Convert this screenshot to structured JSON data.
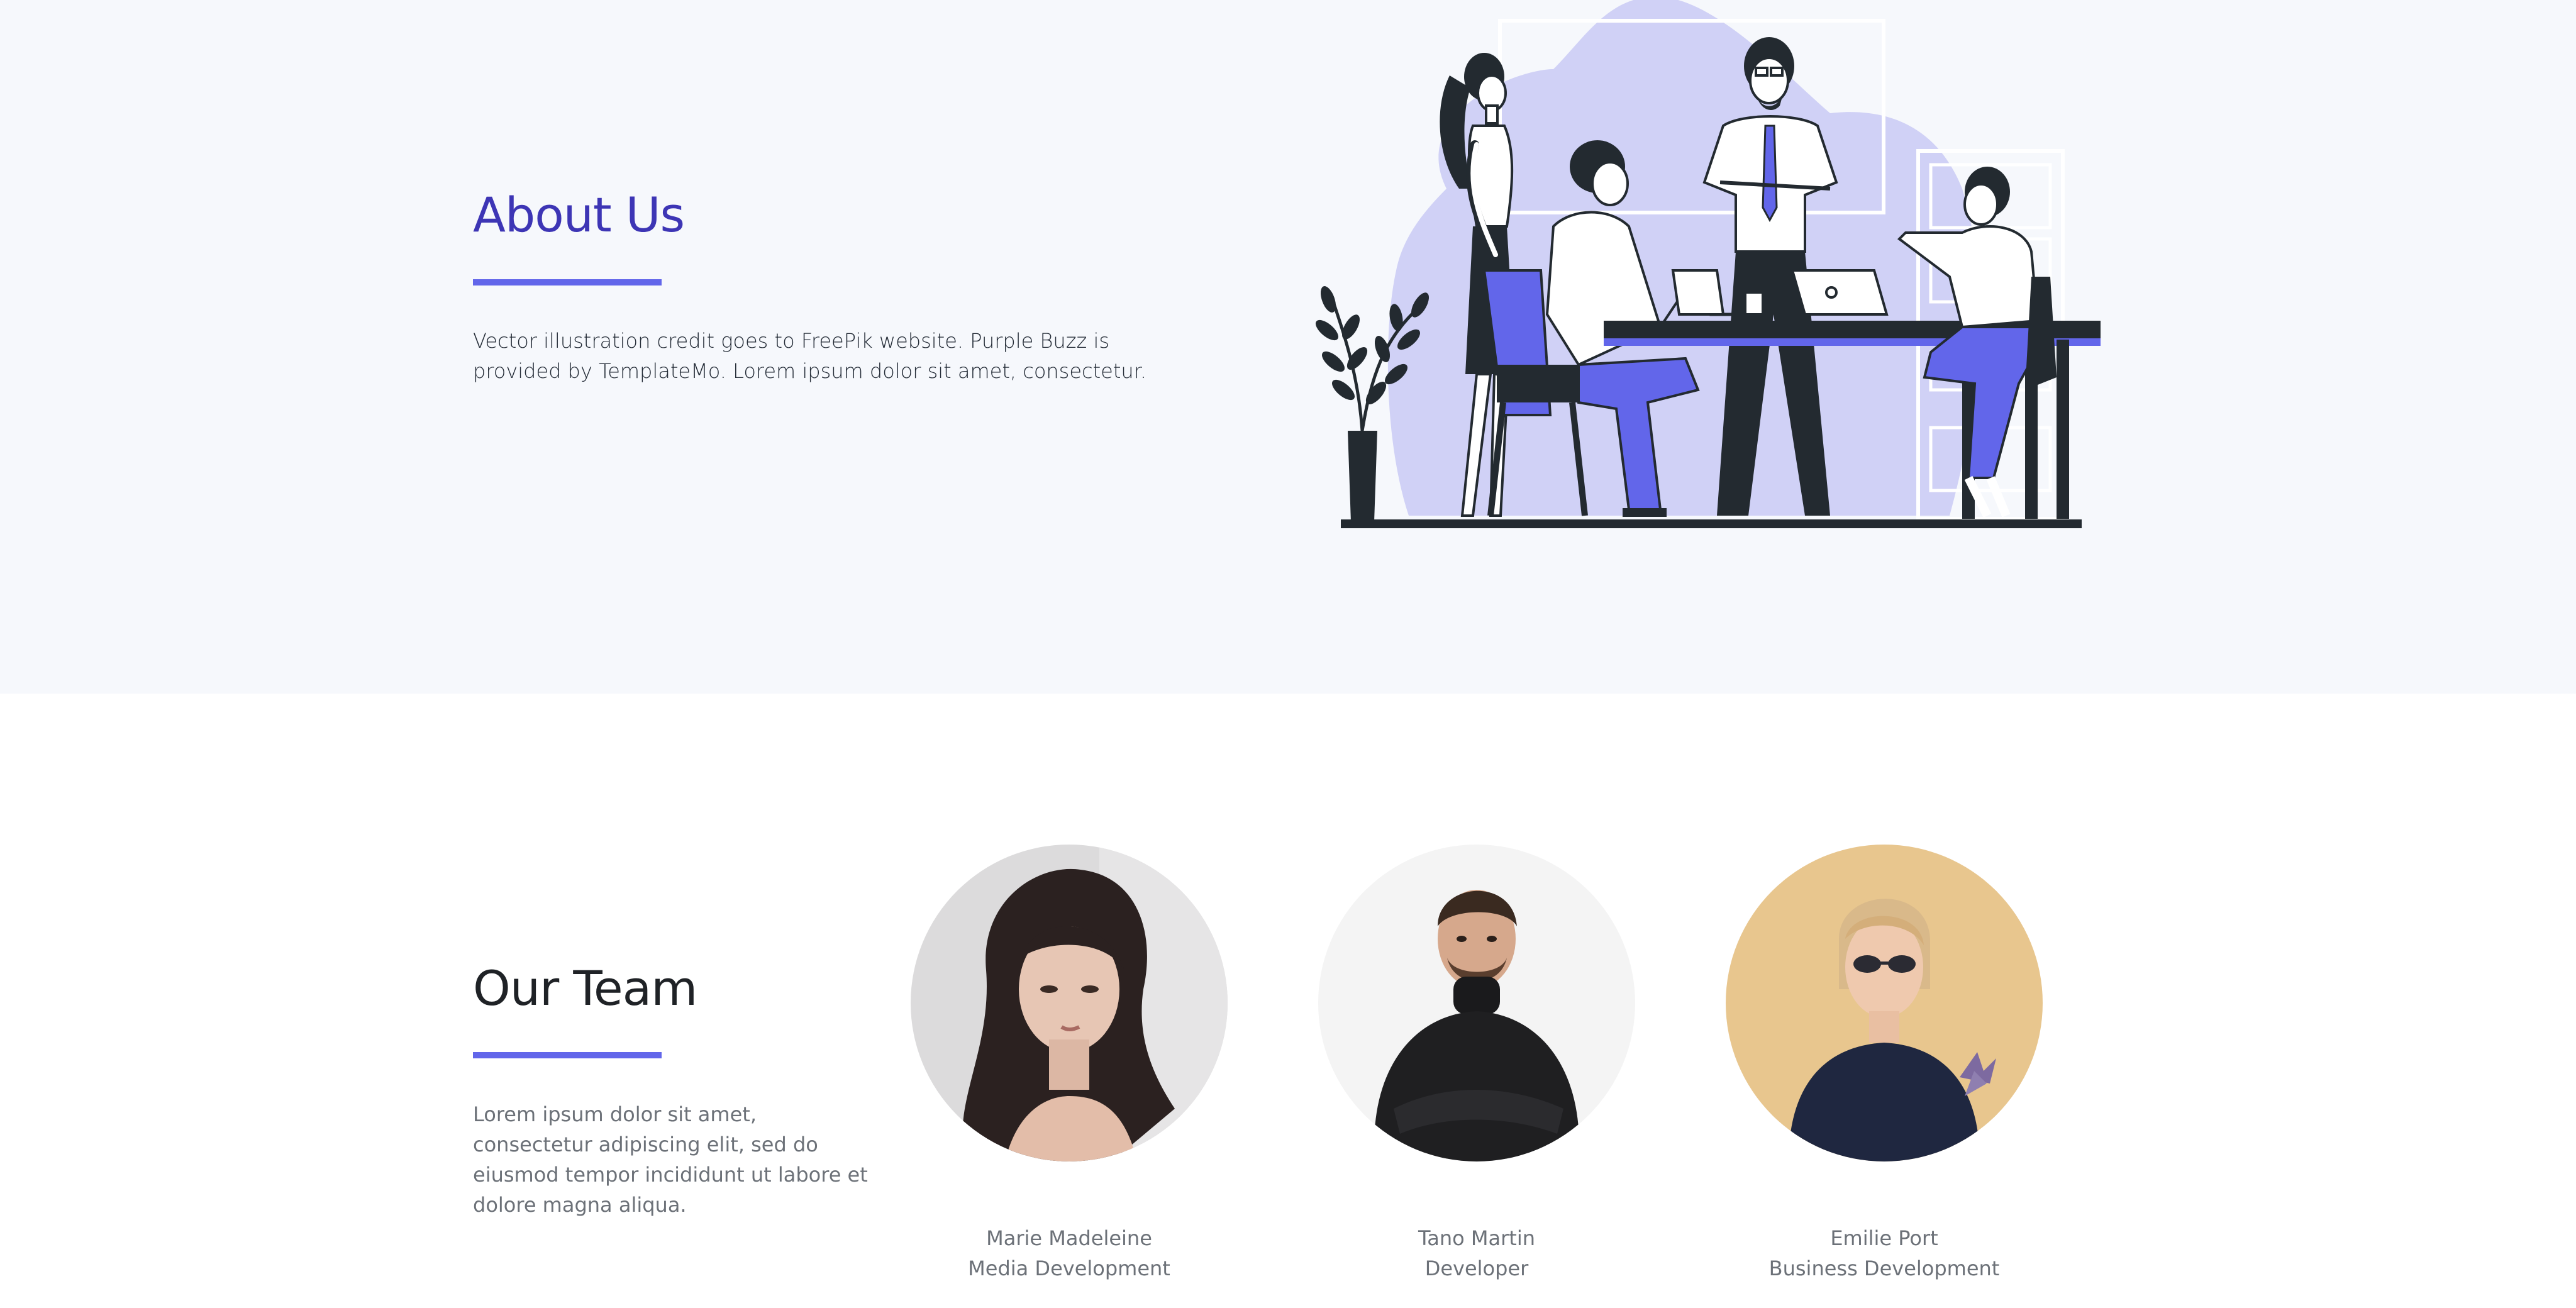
{
  "about": {
    "title": "About Us",
    "text": "Vector illustration credit goes to FreePik website. Purple Buzz is provided by TemplateMo. Lorem ipsum dolor sit amet, consectetur."
  },
  "team": {
    "title": "Our Team",
    "text": "Lorem ipsum dolor sit amet, consectetur adipiscing elit, sed do eiusmod tempor incididunt ut labore et dolore magna aliqua.",
    "members": [
      {
        "name": "Marie Madeleine",
        "role": "Media Development"
      },
      {
        "name": "Tano Martin",
        "role": "Developer"
      },
      {
        "name": "Emilie Port",
        "role": "Business Development"
      }
    ]
  },
  "colors": {
    "accent": "#6266ea",
    "heading_purple": "#3d35b5",
    "about_bg": "#f6f8fc",
    "blob": "#d0d1f6",
    "ink": "#232a30"
  }
}
